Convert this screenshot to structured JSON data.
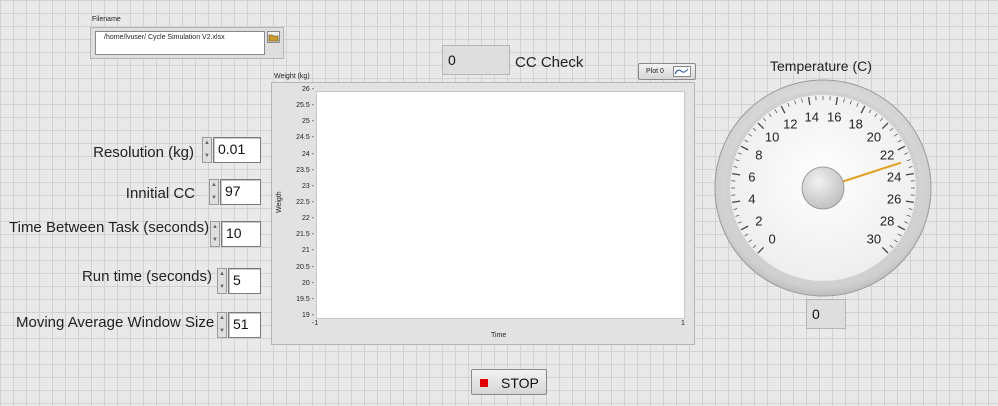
{
  "filename": {
    "label": "Filename",
    "value": "/home/lvuser/ Cycle Simulation V2.xlsx",
    "browse_icon": "folder-icon"
  },
  "cc_check": {
    "value": "0",
    "label": "CC Check"
  },
  "controls": {
    "resolution": {
      "label": "Resolution (kg)",
      "value": "0.01"
    },
    "initial_cc": {
      "label": "Innitial CC",
      "value": "97"
    },
    "time_between": {
      "label": "Time Between Task (seconds)",
      "value": "10"
    },
    "run_time": {
      "label": "Run time (seconds)",
      "value": "5"
    },
    "window_size": {
      "label": "Moving Average Window Size",
      "value": "51"
    }
  },
  "chart": {
    "top_label": "Weight (kg)",
    "legend_label": "Plot 0",
    "ylabel": "Weigth",
    "xlabel": "Time",
    "y_ticks": [
      "26",
      "25.5",
      "25",
      "24.5",
      "24",
      "23.5",
      "23",
      "22.5",
      "22",
      "21.5",
      "21",
      "20.5",
      "20",
      "19.5",
      "19"
    ],
    "x_ticks": [
      "-1",
      "1"
    ]
  },
  "temperature": {
    "title": "Temperature (C)",
    "scale": [
      "0",
      "2",
      "4",
      "6",
      "8",
      "10",
      "12",
      "14",
      "16",
      "18",
      "20",
      "22",
      "24",
      "26",
      "28",
      "30"
    ],
    "needle_value": 23,
    "indicator_value": "0",
    "needle_color": "#e0a020"
  },
  "stop": {
    "label": "STOP",
    "icon": "stop-square-icon",
    "icon_color": "#e00000"
  }
}
